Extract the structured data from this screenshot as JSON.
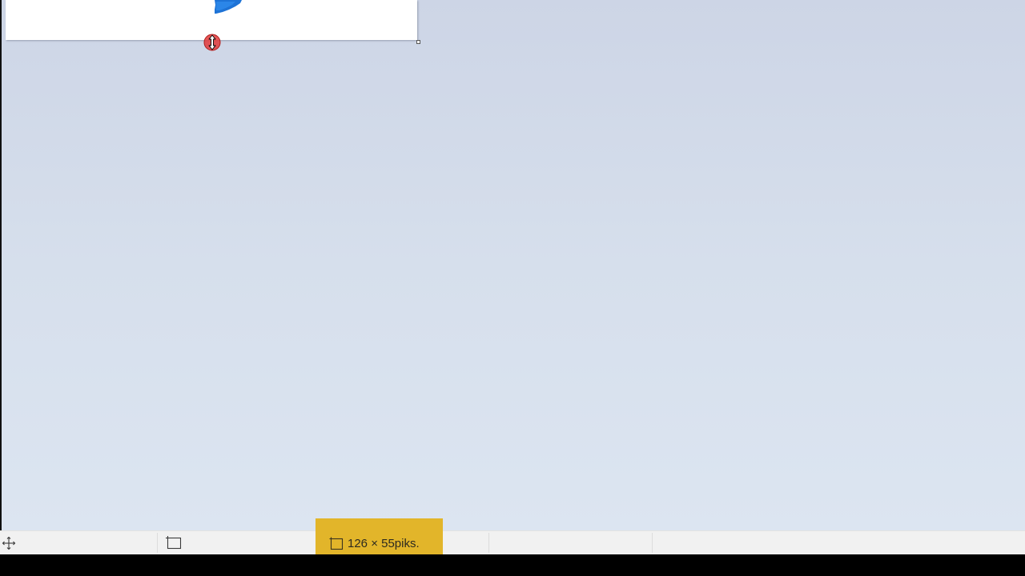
{
  "canvas": {
    "background_color": "#ffffff",
    "stroke_color": "#1e73d6"
  },
  "cursor": {
    "icon": "vertical-resize-cursor-icon"
  },
  "statusbar": {
    "move_icon": "move-arrows-icon",
    "selection_icon": "selection-rect-icon",
    "selection_size": {
      "icon": "selection-rect-icon",
      "text": "126 × 55piks.",
      "highlight_color": "#e2b52a"
    }
  }
}
